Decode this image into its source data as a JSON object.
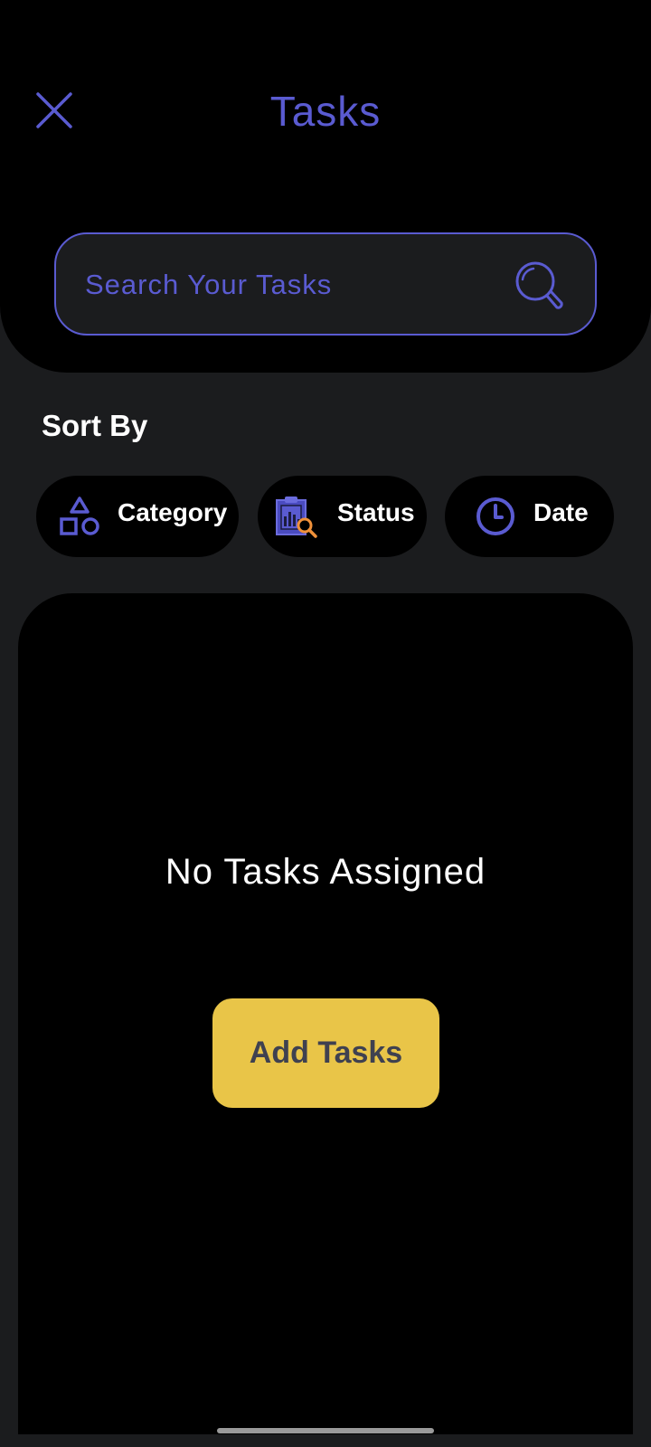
{
  "header": {
    "title": "Tasks",
    "close_icon": "close-icon"
  },
  "search": {
    "placeholder": "Search Your Tasks",
    "value": "",
    "icon": "search-icon"
  },
  "sort": {
    "label": "Sort By",
    "options": [
      {
        "label": "Category",
        "icon": "shapes-icon"
      },
      {
        "label": "Status",
        "icon": "clipboard-chart-search-icon"
      },
      {
        "label": "Date",
        "icon": "clock-icon"
      }
    ]
  },
  "tasks": {
    "empty_message": "No Tasks Assigned",
    "add_button_label": "Add Tasks"
  },
  "colors": {
    "accent": "#5a5bd1",
    "background": "#1b1c1e",
    "surface": "#000000",
    "button_bg": "#e9c548",
    "button_text": "#3f4150",
    "text_white": "#ffffff",
    "status_magnifier": "#f0913a"
  }
}
